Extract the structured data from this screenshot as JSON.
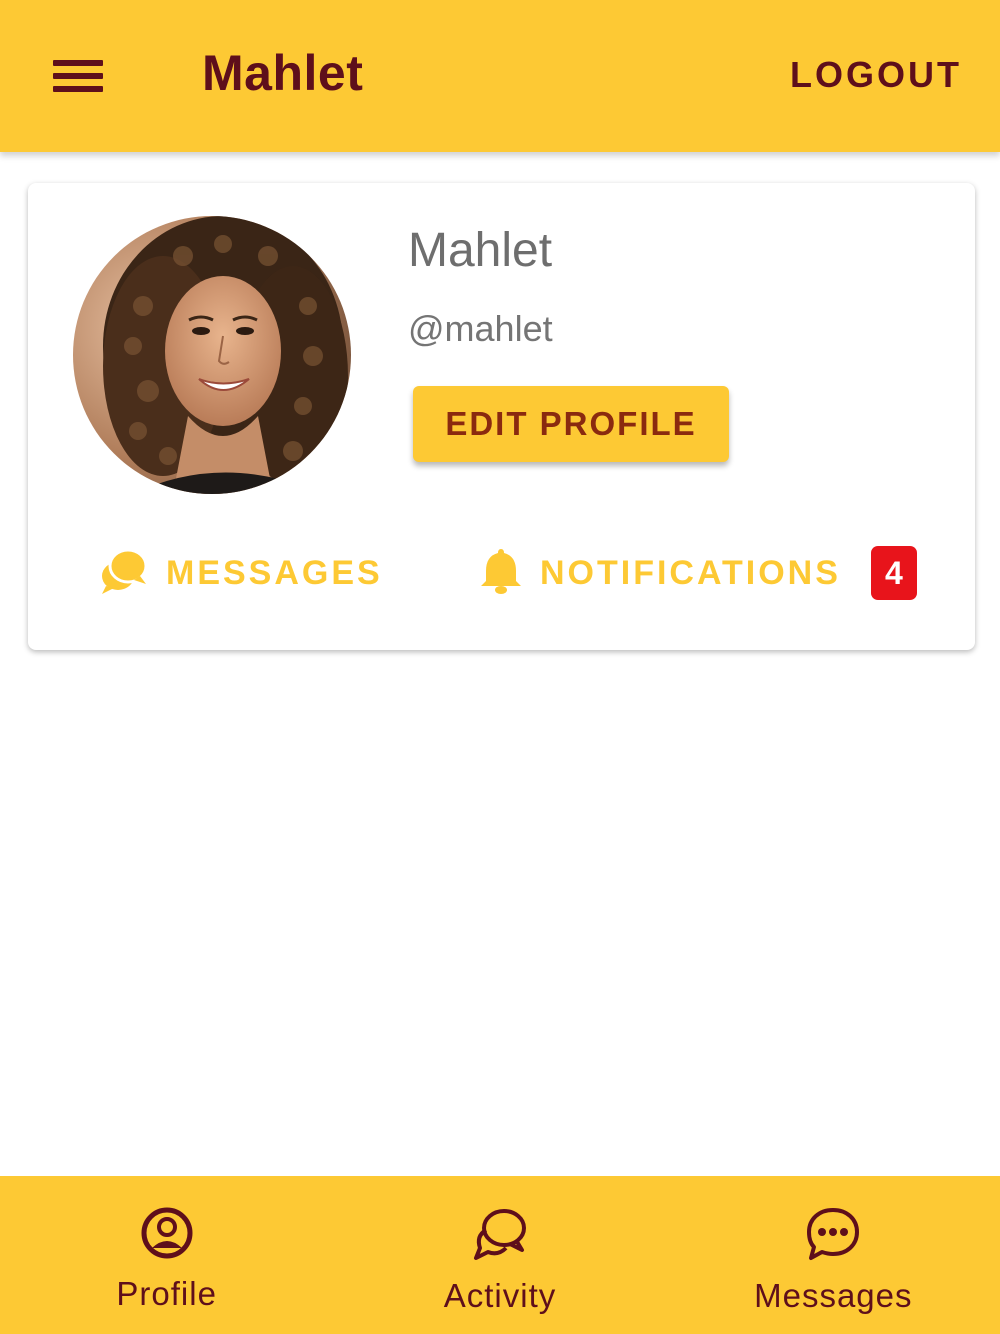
{
  "app_bar": {
    "title": "Mahlet",
    "logout_label": "LOGOUT",
    "menu_icon": "hamburger-menu-icon"
  },
  "profile_card": {
    "name": "Mahlet",
    "handle": "@mahlet",
    "edit_label": "EDIT PROFILE",
    "avatar": "profile-photo"
  },
  "actions": {
    "messages": {
      "label": "MESSAGES",
      "icon": "chat-bubbles-icon"
    },
    "notifications": {
      "label": "NOTIFICATIONS",
      "icon": "bell-icon",
      "count": "4"
    }
  },
  "bottom_nav": {
    "items": [
      {
        "label": "Profile",
        "icon": "person-circle-icon"
      },
      {
        "label": "Activity",
        "icon": "chat-outline-icon"
      },
      {
        "label": "Messages",
        "icon": "chat-dots-icon"
      }
    ]
  },
  "colors": {
    "primary": "#fdc934",
    "accent": "#5e0f1b",
    "badge": "#e8141b"
  }
}
